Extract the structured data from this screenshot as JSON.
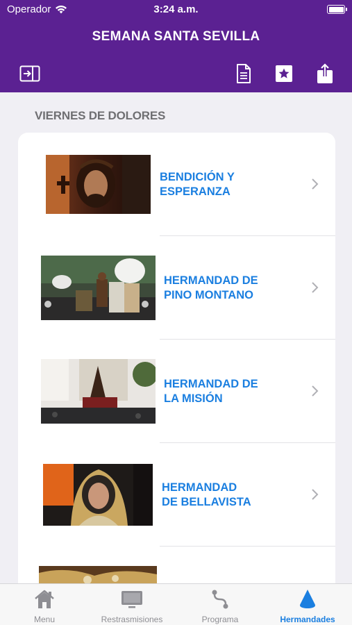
{
  "status": {
    "carrier": "Operador",
    "time": "3:24 a.m."
  },
  "nav": {
    "title": "SEMANA SANTA SEVILLA"
  },
  "section": {
    "header": "VIERNES DE DOLORES"
  },
  "rows": [
    {
      "label": "BENDICIÓN Y\nESPERANZA"
    },
    {
      "label": "HERMANDAD DE\nPINO MONTANO"
    },
    {
      "label": "HERMANDAD DE\nLA MISIÓN"
    },
    {
      "label": "HERMANDAD\nDE BELLAVISTA"
    }
  ],
  "tabs": [
    {
      "label": "Menu",
      "icon": "home-icon"
    },
    {
      "label": "Restrasmisiones",
      "icon": "tv-icon"
    },
    {
      "label": "Programa",
      "icon": "route-icon"
    },
    {
      "label": "Hermandades",
      "icon": "cone-icon"
    }
  ],
  "colors": {
    "header_bg": "#5b2192",
    "accent": "#1b7fe0",
    "tab_inactive": "#8e8e93"
  }
}
